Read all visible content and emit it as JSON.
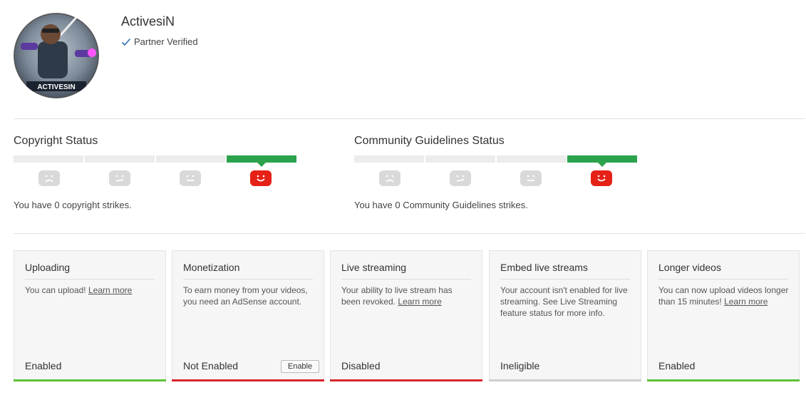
{
  "channel": {
    "name": "ActivesiN",
    "verified_label": "Partner Verified",
    "avatar_logo_text": "ACTIVESIN"
  },
  "copyright": {
    "title": "Copyright Status",
    "strikes_text": "You have 0 copyright strikes.",
    "active_segment": 4
  },
  "community": {
    "title": "Community Guidelines Status",
    "strikes_text": "You have 0 Community Guidelines strikes.",
    "active_segment": 4
  },
  "cards": [
    {
      "title": "Uploading",
      "desc": "You can upload!",
      "link": "Learn more",
      "status": "Enabled",
      "status_color": "green"
    },
    {
      "title": "Monetization",
      "desc": "To earn money from your videos, you need an AdSense account.",
      "status": "Not Enabled",
      "status_color": "red",
      "button": "Enable"
    },
    {
      "title": "Live streaming",
      "desc": "Your ability to live stream has been revoked.",
      "link": "Learn more",
      "status": "Disabled",
      "status_color": "red"
    },
    {
      "title": "Embed live streams",
      "desc": "Your account isn't enabled for live streaming. See Live Streaming feature status for more info.",
      "status": "Ineligible",
      "status_color": "gray"
    },
    {
      "title": "Longer videos",
      "desc": "You can now upload videos longer than 15 minutes!",
      "link": "Learn more",
      "status": "Enabled",
      "status_color": "green"
    }
  ],
  "colors": {
    "green": "#5bc236",
    "red": "#d9262c",
    "gray": "#cfcfcf",
    "strike_green": "#2ba24c",
    "face_red": "#e62117"
  }
}
